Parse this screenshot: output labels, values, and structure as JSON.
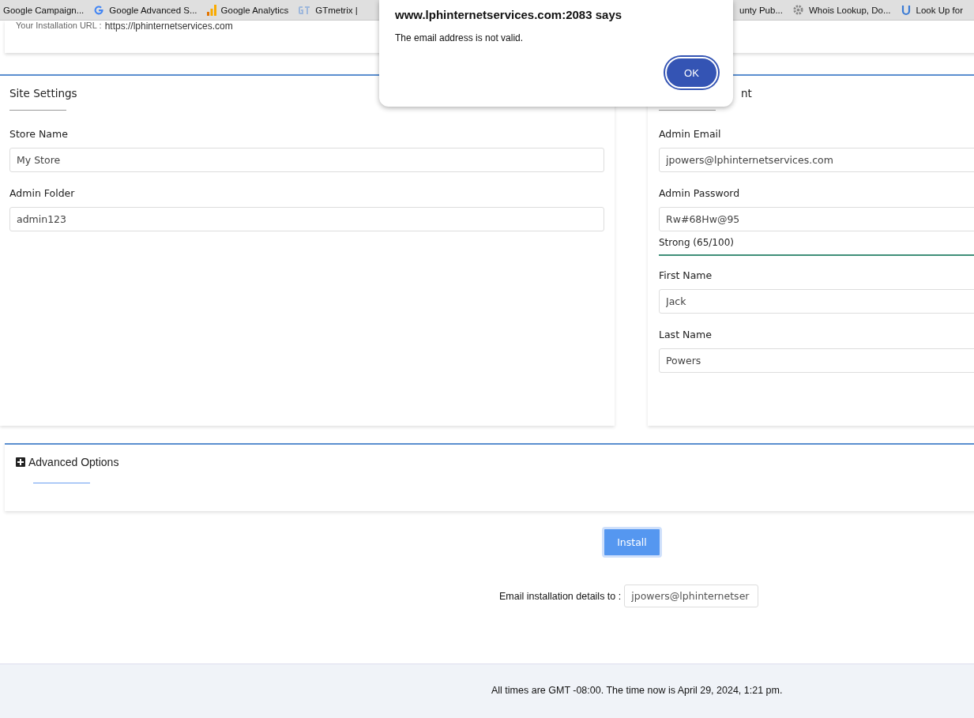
{
  "bookmarks_left": [
    {
      "label": "Google Campaign..."
    },
    {
      "label": "Google Advanced S..."
    },
    {
      "label": "Google Analytics"
    },
    {
      "label": "GTmetrix |"
    }
  ],
  "bookmarks_right": [
    {
      "label": "unty Pub..."
    },
    {
      "label": "Whois Lookup, Do..."
    },
    {
      "label": "Look Up for"
    }
  ],
  "install_url": {
    "label": "Your Installation URL :",
    "value": "https://lphinternetservices.com"
  },
  "site_settings": {
    "title": "Site Settings",
    "fields": [
      {
        "label": "Store Name",
        "value": "My Store"
      },
      {
        "label": "Admin Folder",
        "value": "admin123"
      }
    ]
  },
  "admin_account": {
    "title": "nt",
    "fields": [
      {
        "label": "Admin Email",
        "value": "jpowers@lphinternetservices.com"
      },
      {
        "label": "Admin Password",
        "value": "Rw#68Hw@95",
        "strength": "Strong (65/100)"
      },
      {
        "label": "First Name",
        "value": "Jack"
      },
      {
        "label": "Last Name",
        "value": "Powers"
      }
    ]
  },
  "advanced": {
    "title": "Advanced Options",
    "expanded": false
  },
  "install_button": "Install",
  "email_details": {
    "label": "Email installation details to :",
    "value": "jpowers@lphinternetser"
  },
  "footer": "All times are GMT -08:00. The time now is April 29, 2024, 1:21 pm.",
  "dialog": {
    "title": "www.lphinternetservices.com:2083 says",
    "message": "The email address is not valid.",
    "button": "OK"
  }
}
